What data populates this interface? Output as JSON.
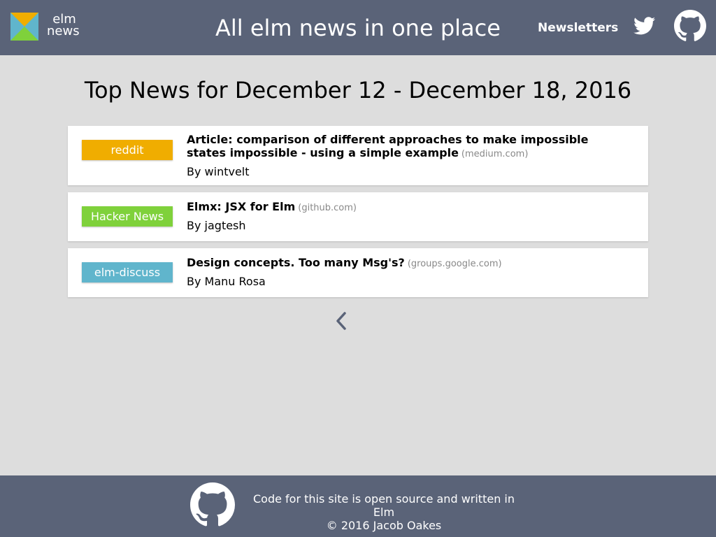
{
  "header": {
    "logo_line1": "elm",
    "logo_line2": "news",
    "title": "All elm news in one place",
    "nav_newsletters": "Newsletters",
    "twitter_icon": "twitter-icon",
    "github_icon": "github-icon"
  },
  "main": {
    "title": "Top News for December 12 - December 18, 2016",
    "items": [
      {
        "source": "reddit",
        "source_color": "#f0ad00",
        "title": "Article: comparison of different approaches to make impossible states impossible - using a simple example",
        "domain": "(medium.com)",
        "author": "By wintvelt"
      },
      {
        "source": "Hacker News",
        "source_color": "#7fd13b",
        "title": "Elmx: JSX for Elm",
        "domain": "(github.com)",
        "author": "By jagtesh"
      },
      {
        "source": "elm-discuss",
        "source_color": "#60b5cc",
        "title": "Design concepts. Too many Msg's?",
        "domain": "(groups.google.com)",
        "author": "By Manu Rosa"
      }
    ],
    "prev_icon": "chevron-left-icon"
  },
  "footer": {
    "line1": "Code for this site is open source and written in Elm",
    "line2": "© 2016 Jacob Oakes",
    "github_icon": "github-icon"
  },
  "colors": {
    "header_bg": "#5a6378",
    "page_bg": "#dddddd",
    "reddit": "#f0ad00",
    "hacker_news": "#7fd13b",
    "elm_discuss": "#60b5cc"
  }
}
